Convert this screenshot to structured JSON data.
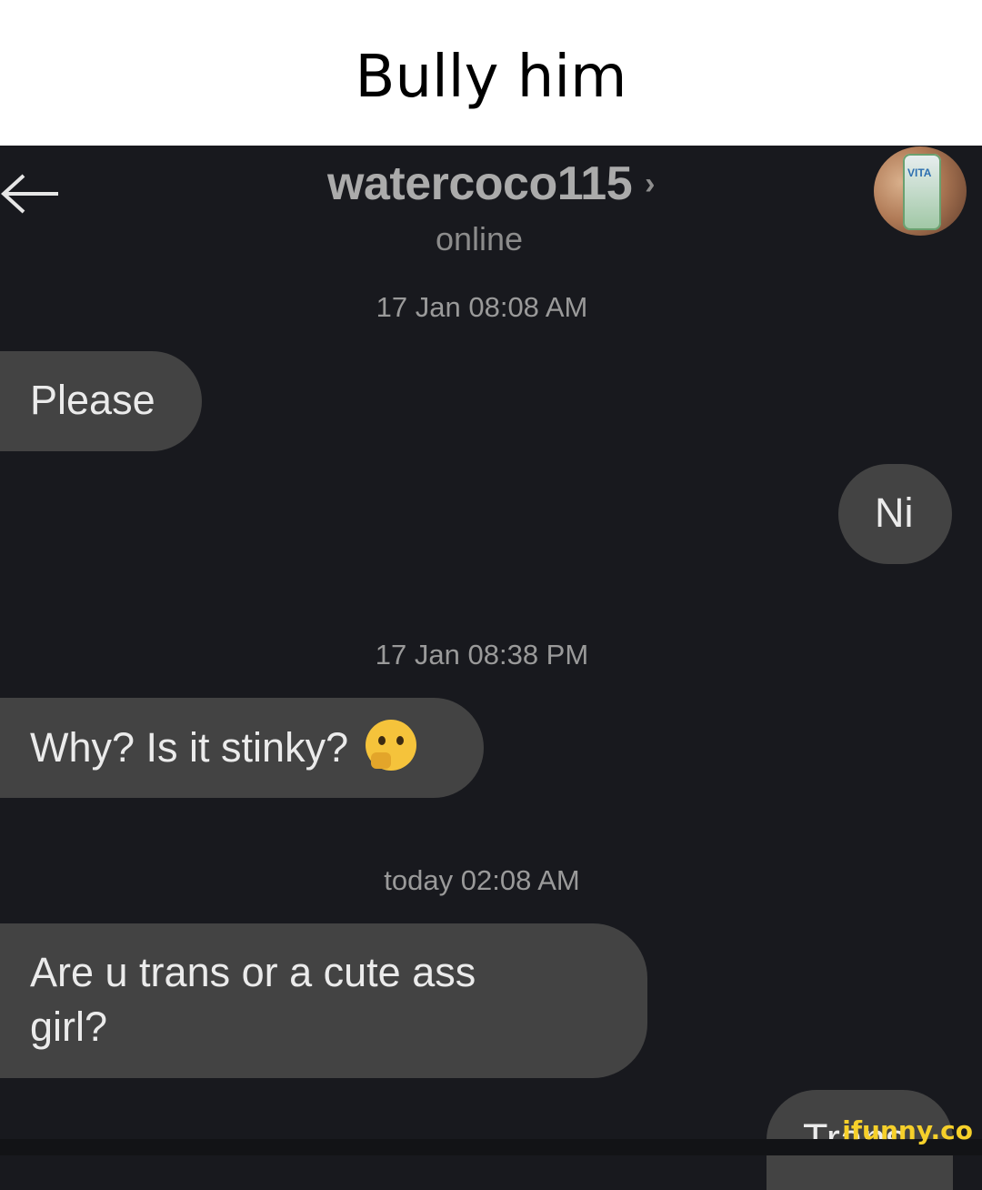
{
  "caption": "Bully him",
  "header": {
    "username": "watercoco115",
    "chevron": "›",
    "status": "online",
    "back_icon": "back-arrow-icon",
    "avatar_icon": "vita-coco-avatar"
  },
  "messages": [
    {
      "type": "timestamp",
      "text": "17 Jan 08:08 AM"
    },
    {
      "type": "received",
      "text": "Please"
    },
    {
      "type": "sent",
      "text": "Ni"
    },
    {
      "type": "timestamp",
      "text": "17 Jan 08:38 PM"
    },
    {
      "type": "received",
      "text": "Why? Is it stinky?",
      "emoji": "thinking-face-emoji"
    },
    {
      "type": "timestamp",
      "text": "today 02:08 AM"
    },
    {
      "type": "received",
      "text": "Are u trans or a cute ass girl?"
    },
    {
      "type": "sent",
      "text": "Trans",
      "partially_visible": true
    }
  ],
  "watermark": "ifunny.co",
  "colors": {
    "background": "#18191e",
    "bubble": "#434343",
    "watermark": "#f6d02a"
  }
}
